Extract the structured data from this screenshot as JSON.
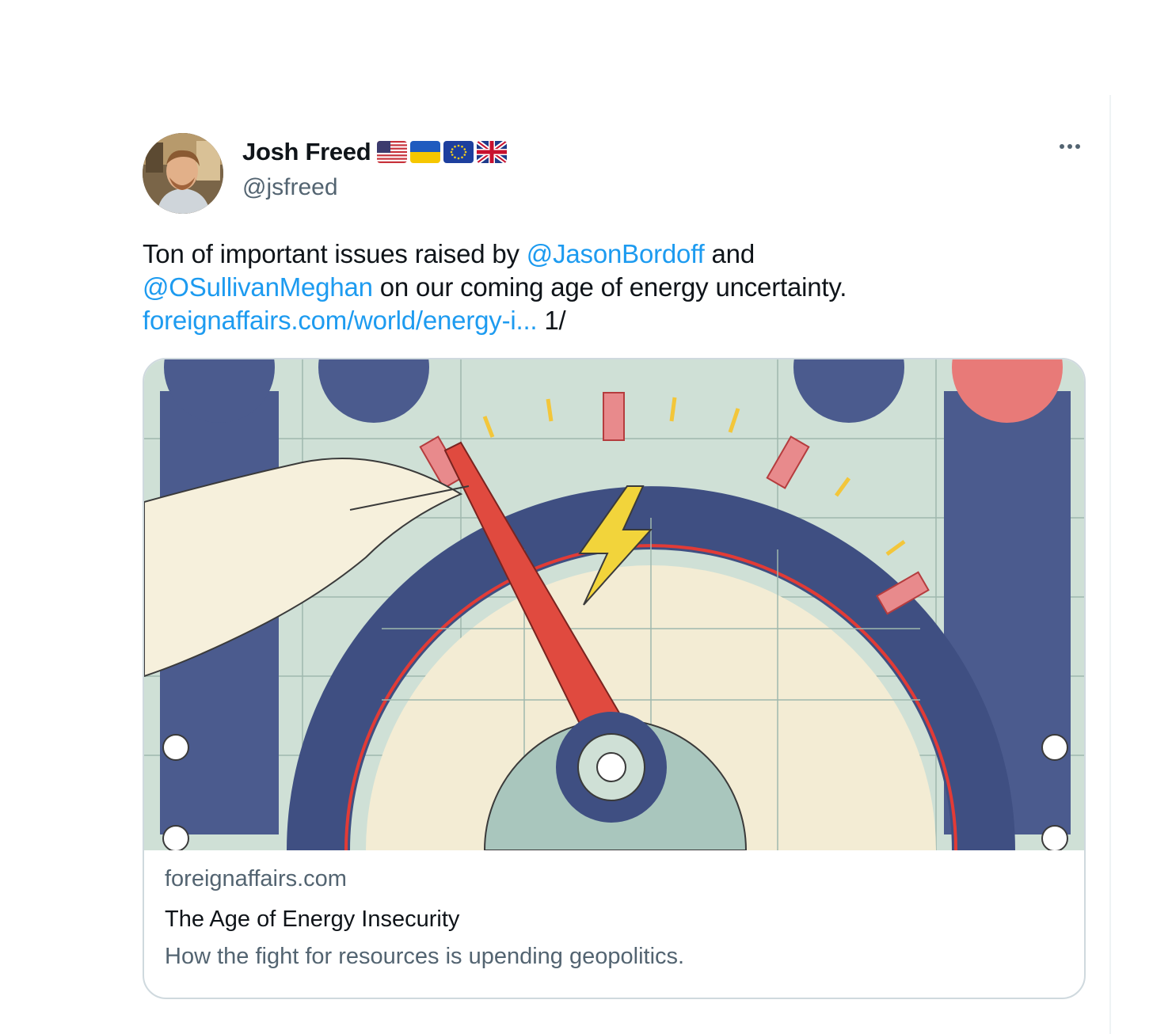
{
  "tweet": {
    "author": {
      "display_name": "Josh Freed",
      "handle": "@jsfreed",
      "flags": [
        "us-flag-icon",
        "ukraine-flag-icon",
        "eu-flag-icon",
        "uk-flag-icon"
      ]
    },
    "more_icon": "more-horizontal-icon",
    "text": {
      "part1": "Ton of important issues raised by ",
      "mention1": "@JasonBordoff",
      "part2": " and",
      "mention2": "@OSullivanMeghan",
      "part3": " on our coming age of energy uncertainty.",
      "url": "foreignaffairs.com/world/energy-i...",
      "suffix": " 1/"
    },
    "card": {
      "domain": "foreignaffairs.com",
      "title": "The Age of Energy Insecurity",
      "description": "How the fight for resources is upending geopolitics."
    }
  },
  "colors": {
    "link": "#1d9bf0",
    "secondary_text": "#536471",
    "border": "#cfd9de"
  }
}
